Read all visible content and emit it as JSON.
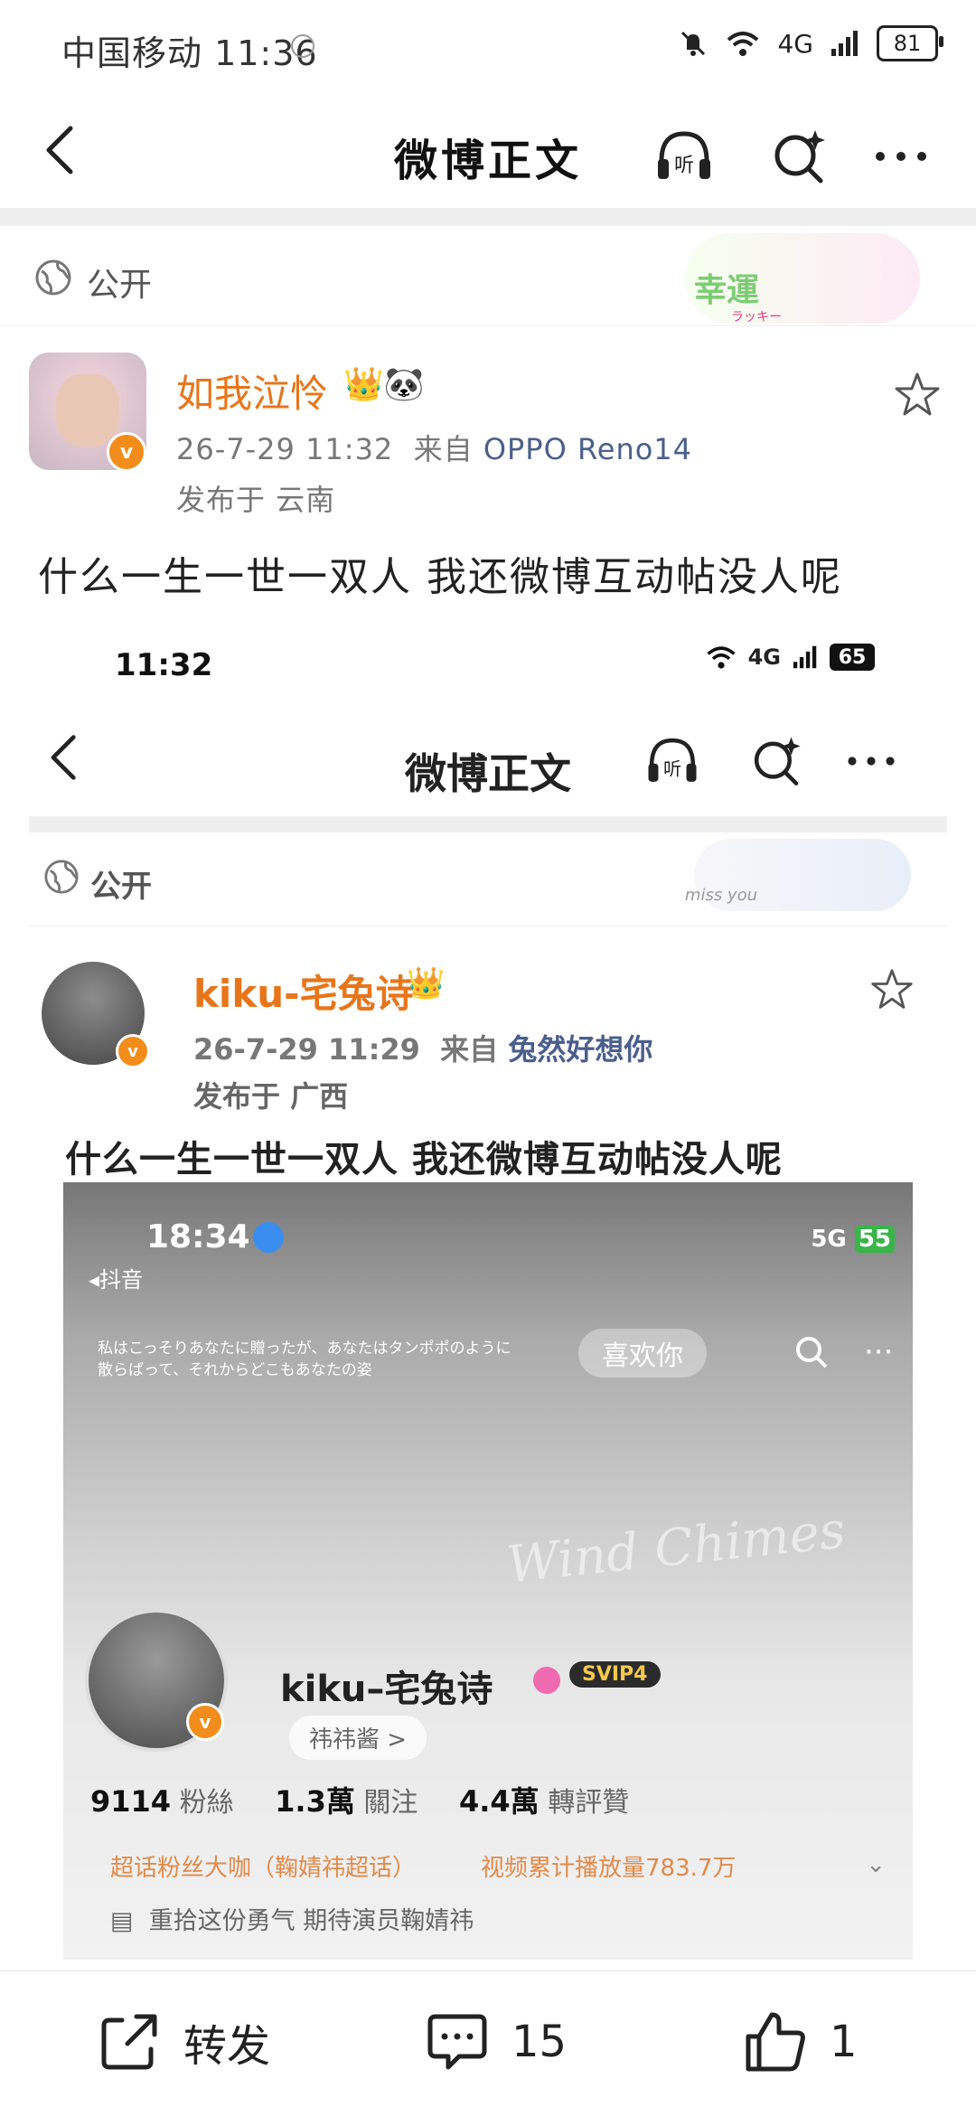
{
  "status_bar": {
    "carrier_time": "中国移动 11:36",
    "network": "4G",
    "battery": "81"
  },
  "header": {
    "title": "微博正文",
    "listen_label": "听"
  },
  "visibility": "公开",
  "sticker_text": "幸運",
  "sticker_sub": "ラッキー",
  "author": {
    "name": "如我泣怜",
    "badges": "👑🐼",
    "verified": "v"
  },
  "meta": {
    "time": "26-7-29 11:32",
    "from_label": "来自",
    "source": "OPPO Reno14",
    "location": "发布于 云南"
  },
  "post_text": "什么一生一世一双人 我还微博互动帖没人呢",
  "inner": {
    "status": {
      "time": "11:32",
      "network": "4G",
      "battery": "65"
    },
    "header": {
      "title": "微博正文",
      "listen_label": "听"
    },
    "visibility": "公开",
    "sticker_text": "miss you",
    "author": {
      "name": "kiku-宅兔诗",
      "verified": "v"
    },
    "meta": {
      "time": "26-7-29 11:29",
      "from_label": "来自",
      "source": "兔然好想你",
      "location": "发布于 广西"
    },
    "post_text": "什么一生一世一双人 我还微博互动帖没人呢",
    "image": {
      "time": "18:34",
      "app": "◂抖音",
      "network": "5G",
      "battery": "55",
      "jp_text": "私はこっそりあなたに贈ったが、あなたはタンポポのように散らばって、それからどこもあなたの姿",
      "like_label": "喜欢你",
      "watermark": "Wind Chimes",
      "name": "kiku–宅兔诗",
      "svip": "SVIP4",
      "tag": "祎祎酱 >",
      "stats": [
        {
          "num": "9114",
          "label": "粉絲"
        },
        {
          "num": "1.3萬",
          "label": "關注"
        },
        {
          "num": "4.4萬",
          "label": "轉評贊"
        }
      ],
      "line2_left": "超话粉丝大咖（鞠婧祎超话）",
      "line2_right": "视频累计播放量783.7万",
      "signature": "重拾这份勇气 期待演员鞠婧祎"
    }
  },
  "bottom_bar": {
    "repost_label": "转发",
    "comments": "15",
    "likes": "1"
  },
  "colors": {
    "accent_orange": "#e8751a",
    "link_blue": "#4a5f8d",
    "verified": "#f28c1a"
  }
}
